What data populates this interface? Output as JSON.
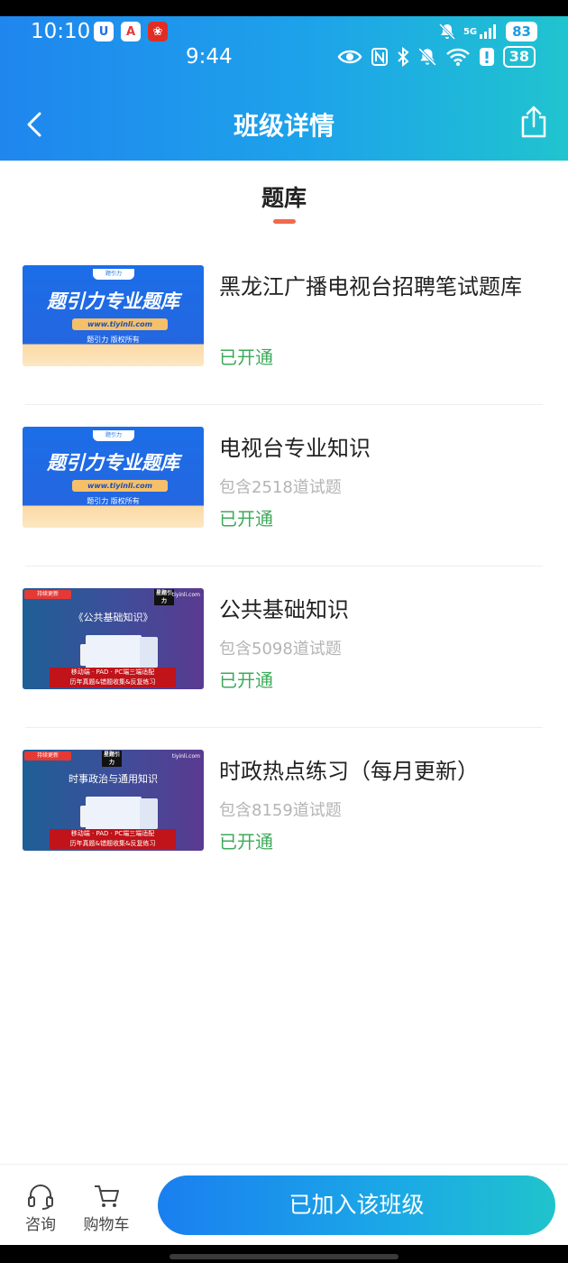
{
  "status_bar_outer": {
    "time": "10:10",
    "battery": "83",
    "network": "5G"
  },
  "status_bar_inner": {
    "time": "9:44",
    "battery": "38"
  },
  "nav": {
    "title": "班级详情",
    "back_icon": "chevron-left-icon",
    "share_icon": "share-icon"
  },
  "tab": {
    "label": "题库"
  },
  "items": [
    {
      "title": "黑龙江广播电视台招聘笔试题库",
      "count": "",
      "status": "已开通",
      "thumb": {
        "style": "blue",
        "brand": "题引力",
        "title": "题引力专业题库",
        "url": "www.tiyinli.com",
        "copyright": "题引力 版权所有"
      }
    },
    {
      "title": "电视台专业知识",
      "count": "包含2518道试题",
      "status": "已开通",
      "thumb": {
        "style": "blue",
        "brand": "题引力",
        "title": "题引力专业题库",
        "url": "www.tiyinli.com",
        "copyright": "题引力 版权所有"
      }
    },
    {
      "title": "公共基础知识",
      "count": "包含5098道试题",
      "status": "已开通",
      "thumb": {
        "style": "purple",
        "badge": "持续更新",
        "logo": "星题引力",
        "site": "tiyinli.com",
        "title": "《公共基础知识》",
        "banner_line1": "移动端 · PAD · PC端三端适配",
        "banner_line2": "历年真题&错题收集&反复练习"
      }
    },
    {
      "title": "时政热点练习（每月更新）",
      "count": "包含8159道试题",
      "status": "已开通",
      "thumb": {
        "style": "purple",
        "badge": "持续更新",
        "logo": "星题引力",
        "site": "tiyinli.com",
        "title": "时事政治与通用知识",
        "banner_line1": "移动端 · PAD · PC端三端适配",
        "banner_line2": "历年真题&错题收集&反复练习"
      }
    }
  ],
  "bottom_bar": {
    "consult_label": "咨询",
    "cart_label": "购物车",
    "join_label": "已加入该班级"
  },
  "colors": {
    "accent_blue": "#1a7ff0",
    "accent_teal": "#20c3cc",
    "status_green": "#3eaa5a",
    "tab_indicator": "#ef6a4c"
  }
}
